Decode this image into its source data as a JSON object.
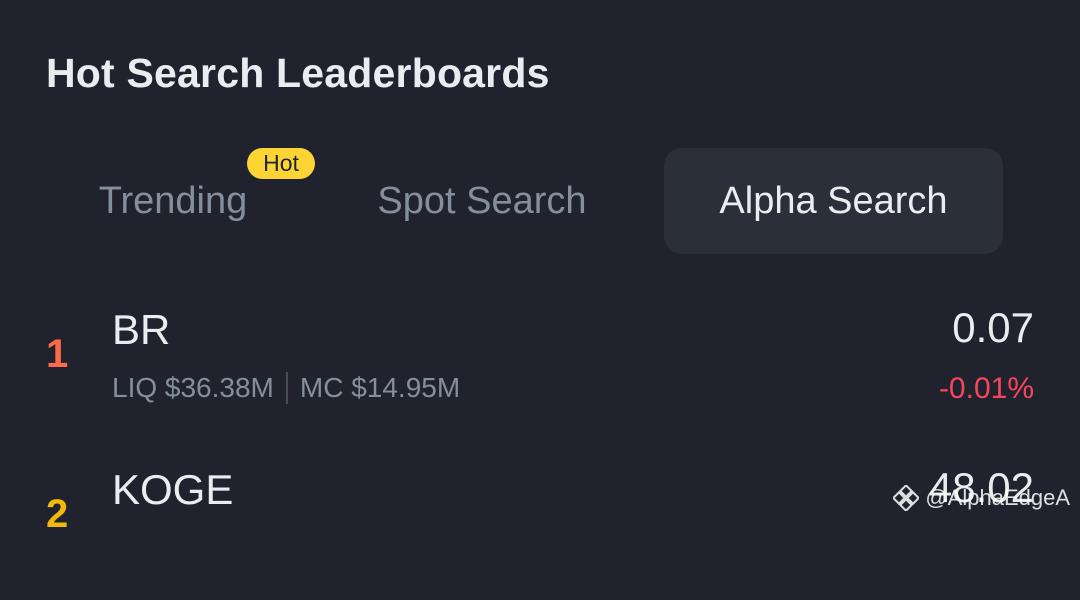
{
  "header": {
    "title": "Hot Search Leaderboards"
  },
  "tabs": [
    {
      "label": "Trending",
      "badge": "Hot",
      "active": false
    },
    {
      "label": "Spot Search",
      "active": false
    },
    {
      "label": "Alpha Search",
      "active": true
    }
  ],
  "rows": [
    {
      "rank": "1",
      "symbol": "BR",
      "liq": "LIQ $36.38M",
      "mc": "MC $14.95M",
      "price": "0.07",
      "change": "-0.01%"
    },
    {
      "rank": "2",
      "symbol": "KOGE",
      "price": "48.02"
    }
  ],
  "watermark": {
    "text": "@AlphaEdgeA"
  },
  "colors": {
    "background": "#20232d",
    "accent": "#fcd535",
    "negative": "#f6465d",
    "rank1": "#ff6b4a",
    "rank2": "#f0b90b"
  }
}
